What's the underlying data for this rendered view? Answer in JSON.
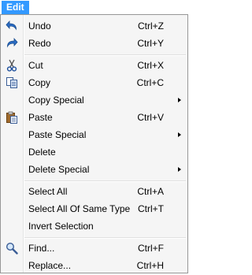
{
  "menubar": {
    "title": "Edit"
  },
  "menu": {
    "items": [
      {
        "label": "Undo",
        "shortcut": "Ctrl+Z",
        "icon": "undo-icon"
      },
      {
        "label": "Redo",
        "shortcut": "Ctrl+Y",
        "icon": "redo-icon"
      },
      {
        "label": "Cut",
        "shortcut": "Ctrl+X",
        "icon": "cut-icon"
      },
      {
        "label": "Copy",
        "shortcut": "Ctrl+C",
        "icon": "copy-icon"
      },
      {
        "label": "Copy Special",
        "submenu": true
      },
      {
        "label": "Paste",
        "shortcut": "Ctrl+V",
        "icon": "paste-icon"
      },
      {
        "label": "Paste Special",
        "submenu": true
      },
      {
        "label": "Delete"
      },
      {
        "label": "Delete Special",
        "submenu": true
      },
      {
        "label": "Select All",
        "shortcut": "Ctrl+A"
      },
      {
        "label": "Select All Of Same Type",
        "shortcut": "Ctrl+T"
      },
      {
        "label": "Invert Selection"
      },
      {
        "label": "Find...",
        "shortcut": "Ctrl+F",
        "icon": "find-icon"
      },
      {
        "label": "Replace...",
        "shortcut": "Ctrl+H"
      }
    ]
  },
  "colors": {
    "highlight": "#3399ff",
    "menu_background": "#f5f5f5",
    "border": "#979797"
  }
}
